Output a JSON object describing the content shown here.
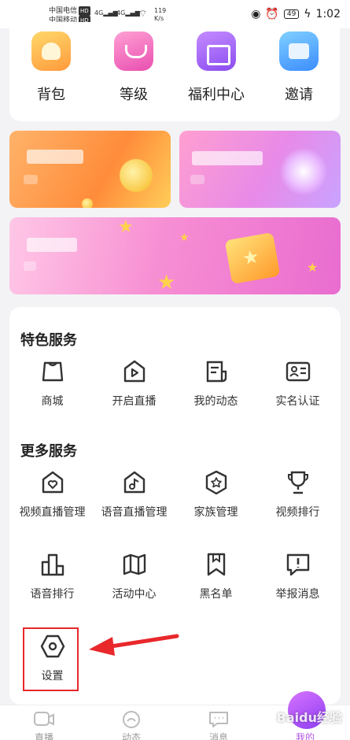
{
  "status_bar": {
    "carrier1": "中国电信",
    "carrier2": "中国移动",
    "hd": "HD",
    "signal1": "4G",
    "signal2": "4G",
    "net_speed": "119",
    "net_unit": "K/s",
    "battery": "49",
    "time": "1:02"
  },
  "top_actions": [
    {
      "label": "背包",
      "icon": "backpack-icon"
    },
    {
      "label": "等级",
      "icon": "level-icon"
    },
    {
      "label": "福利中心",
      "icon": "gift-icon"
    },
    {
      "label": "邀请",
      "icon": "invite-icon"
    }
  ],
  "featured": {
    "title": "特色服务",
    "items": [
      {
        "label": "商城",
        "icon": "shop-bag-icon"
      },
      {
        "label": "开启直播",
        "icon": "live-play-icon"
      },
      {
        "label": "我的动态",
        "icon": "moments-icon"
      },
      {
        "label": "实名认证",
        "icon": "id-card-icon"
      }
    ]
  },
  "more": {
    "title": "更多服务",
    "items": [
      {
        "label": "视频直播管理",
        "icon": "video-live-manage-icon"
      },
      {
        "label": "语音直播管理",
        "icon": "voice-live-manage-icon"
      },
      {
        "label": "家族管理",
        "icon": "family-icon"
      },
      {
        "label": "视频排行",
        "icon": "trophy-icon"
      },
      {
        "label": "语音排行",
        "icon": "podium-icon"
      },
      {
        "label": "活动中心",
        "icon": "map-icon"
      },
      {
        "label": "黑名单",
        "icon": "bookmark-icon"
      },
      {
        "label": "举报消息",
        "icon": "report-icon"
      },
      {
        "label": "设置",
        "icon": "settings-hex-icon"
      }
    ]
  },
  "tabs": [
    {
      "label": "直播",
      "icon": "live-tab-icon"
    },
    {
      "label": "动态",
      "icon": "moments-tab-icon"
    },
    {
      "label": "消息",
      "icon": "message-tab-icon"
    },
    {
      "label": "我的",
      "icon": "profile-tab-icon"
    }
  ],
  "watermark": "Baidu经验",
  "colors": {
    "accent": "#b455e6",
    "highlight": "#e8282b"
  }
}
